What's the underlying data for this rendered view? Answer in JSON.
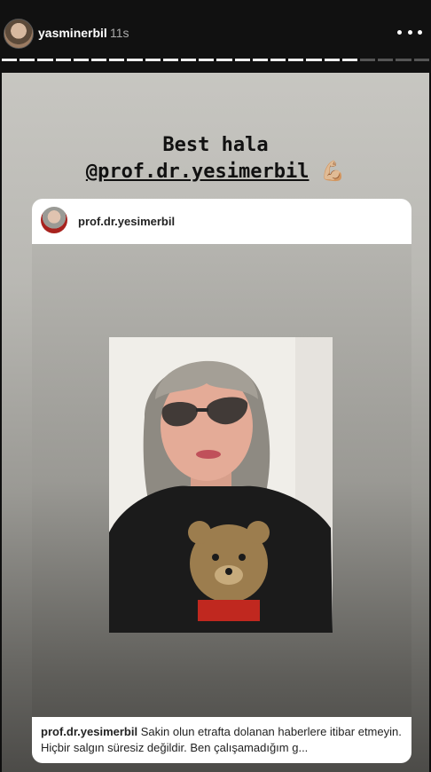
{
  "header": {
    "username": "yasminerbil",
    "time": "11s",
    "more_icon": "more-horizontal-icon",
    "progress": {
      "segments_total": 24,
      "segments_seen": 20
    }
  },
  "story": {
    "caption_line1": "Best hala",
    "mention": "@prof.dr.yesimerbil",
    "emoji": "💪🏼"
  },
  "post": {
    "username": "prof.dr.yesimerbil",
    "caption_user": "prof.dr.yesimerbil",
    "caption_text": "Sakin olun etrafta dolanan haberlere itibar etmeyin. Hiçbir salgın süresiz değildir. Ben çalışamadığım g..."
  }
}
